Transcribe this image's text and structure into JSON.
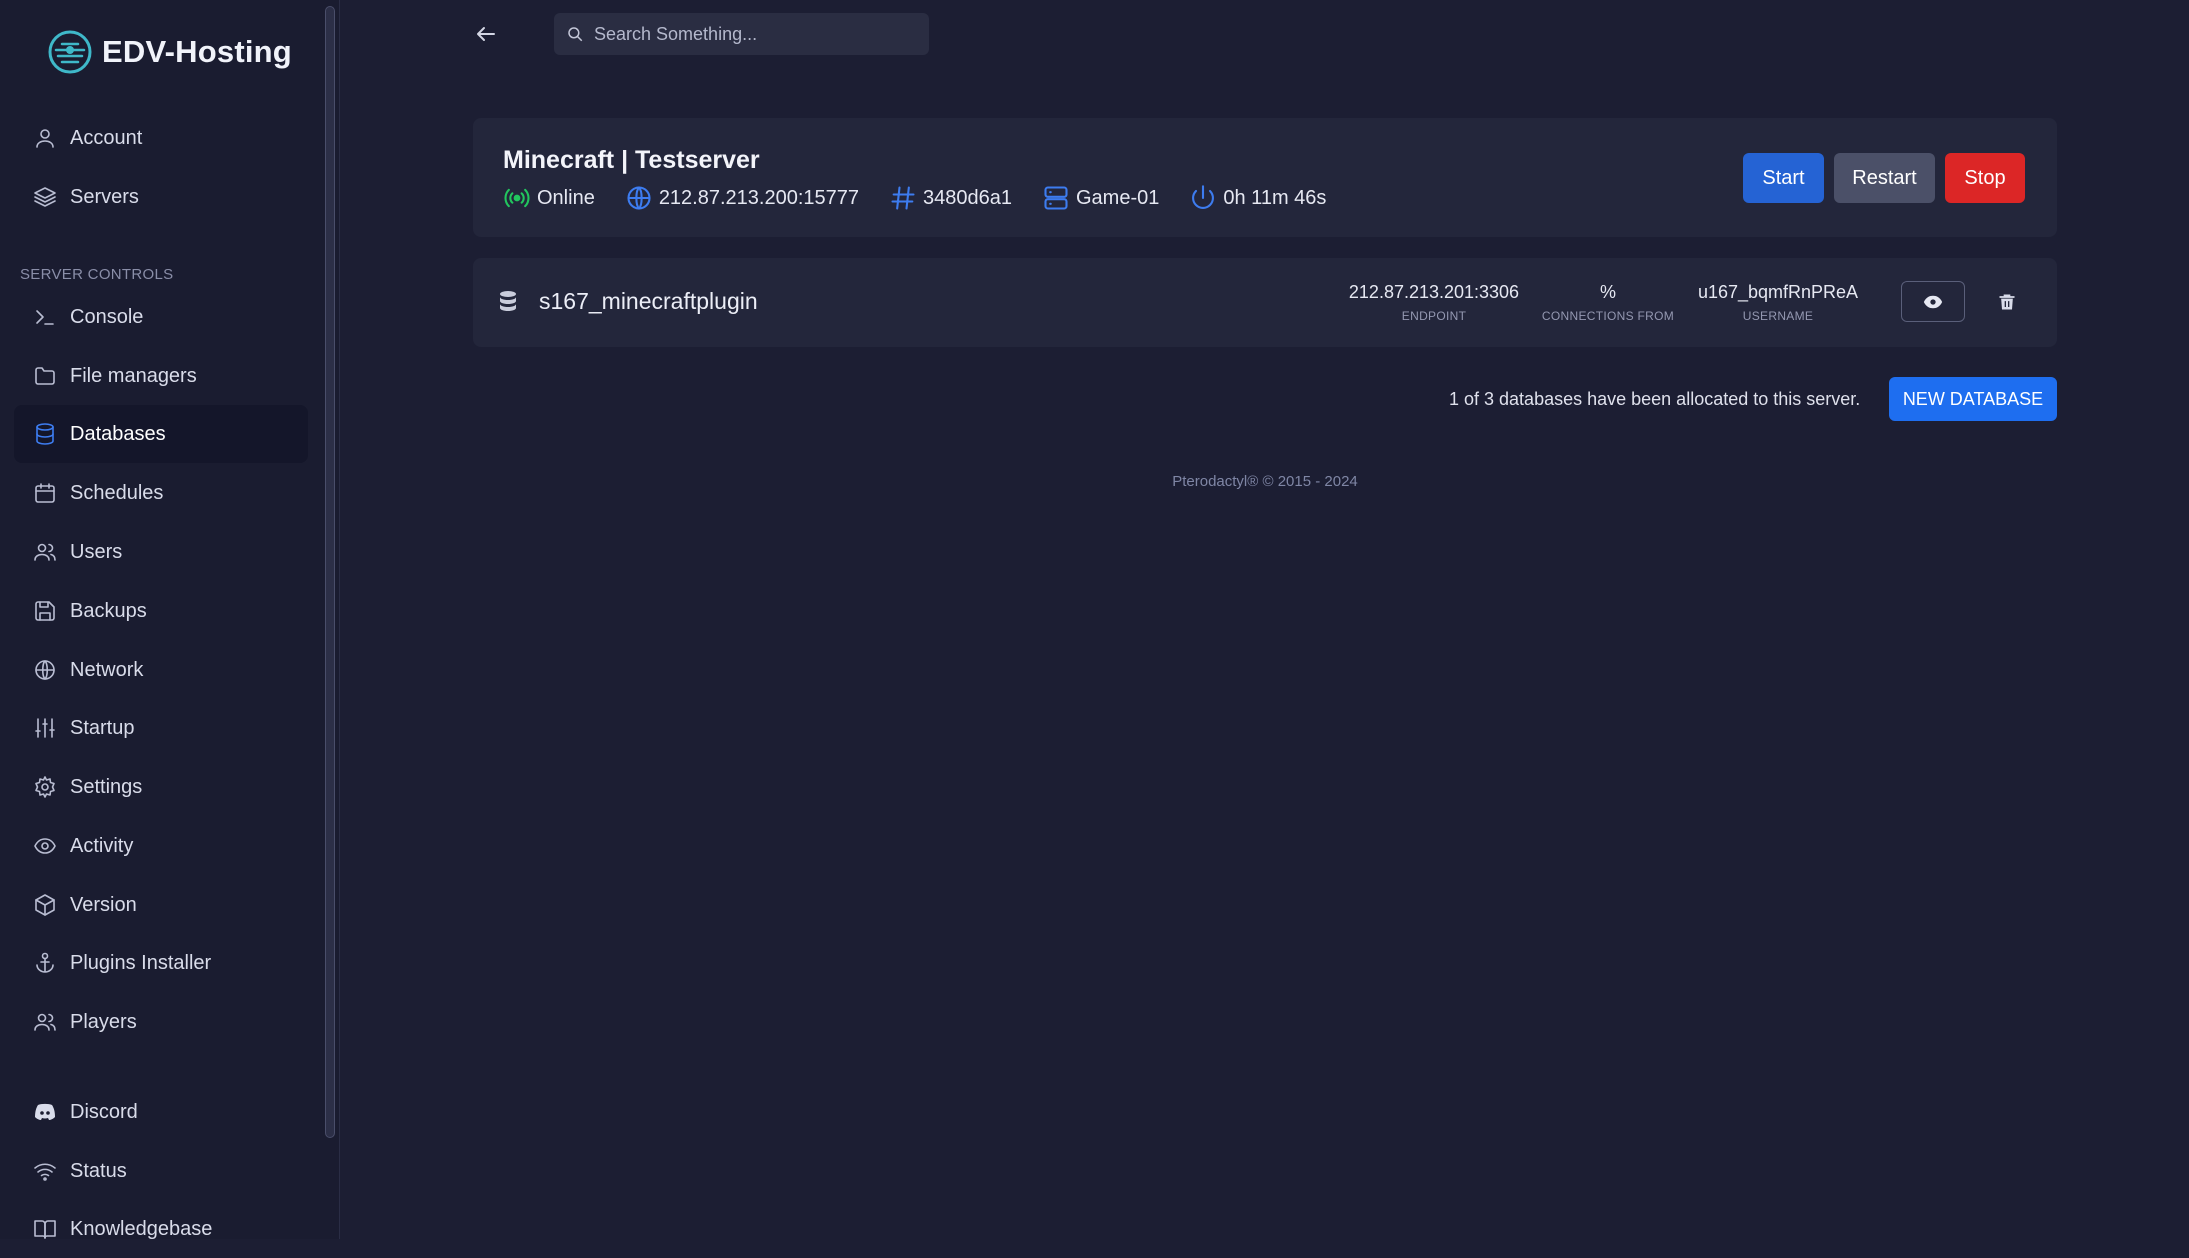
{
  "brand": {
    "name": "EDV-Hosting"
  },
  "sidebar": {
    "top_items": [
      {
        "label": "Account",
        "icon": "user-icon"
      },
      {
        "label": "Servers",
        "icon": "layers-icon"
      }
    ],
    "section_label": "SERVER CONTROLS",
    "control_items": [
      {
        "label": "Console",
        "icon": "terminal-icon"
      },
      {
        "label": "File managers",
        "icon": "folder-icon"
      },
      {
        "label": "Databases",
        "icon": "database-icon",
        "active": true
      },
      {
        "label": "Schedules",
        "icon": "calendar-icon"
      },
      {
        "label": "Users",
        "icon": "users-icon"
      },
      {
        "label": "Backups",
        "icon": "save-icon"
      },
      {
        "label": "Network",
        "icon": "globe-icon"
      },
      {
        "label": "Startup",
        "icon": "sliders-icon"
      },
      {
        "label": "Settings",
        "icon": "gear-icon"
      },
      {
        "label": "Activity",
        "icon": "eye-icon"
      },
      {
        "label": "Version",
        "icon": "box-icon"
      },
      {
        "label": "Plugins Installer",
        "icon": "anchor-icon"
      },
      {
        "label": "Players",
        "icon": "users-icon"
      }
    ],
    "bottom_items": [
      {
        "label": "Discord",
        "icon": "discord-icon"
      },
      {
        "label": "Status",
        "icon": "wifi-icon"
      },
      {
        "label": "Knowledgebase",
        "icon": "book-icon"
      }
    ]
  },
  "search": {
    "placeholder": "Search Something..."
  },
  "server": {
    "title": "Minecraft | Testserver",
    "status": "Online",
    "address": "212.87.213.200:15777",
    "id": "3480d6a1",
    "node": "Game-01",
    "uptime": "0h 11m 46s",
    "buttons": {
      "start": "Start",
      "restart": "Restart",
      "stop": "Stop"
    }
  },
  "database": {
    "name": "s167_minecraftplugin",
    "endpoint": "212.87.213.201:3306",
    "endpoint_label": "ENDPOINT",
    "connections_from": "%",
    "connections_label": "CONNECTIONS FROM",
    "username": "u167_bqmfRnPReA",
    "username_label": "USERNAME"
  },
  "allocation_text": "1 of 3 databases have been allocated to this server.",
  "new_database_label": "NEW DATABASE",
  "footer": "Pterodactyl® © 2015 - 2024",
  "colors": {
    "background": "#1c1e33",
    "accent": "#2563d4",
    "danger": "#dc2626",
    "online": "#22c55e"
  }
}
